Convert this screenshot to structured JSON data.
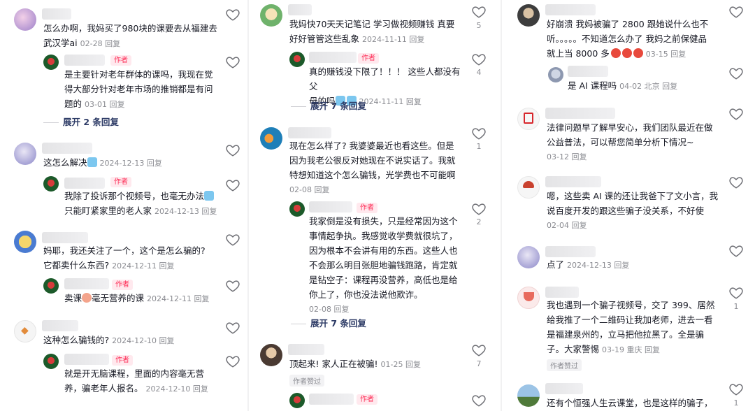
{
  "col1": {
    "c1": {
      "text": "怎么办啊，我妈买了980块的课要去从福建去武汉学ai",
      "meta": "02-28 回复"
    },
    "c1r": {
      "badge": "作者",
      "text": "是主要针对老年群体的课吗，我现在觉得大部分针对老年市场的推销都是有问题的",
      "meta": "03-01 回复"
    },
    "c1e": "展开 2 条回复",
    "c2": {
      "text": "这怎么解决",
      "meta": "2024-12-13 回复"
    },
    "c2r": {
      "badge": "作者",
      "text1": "我除了投诉那个视频号，也毫无办法",
      "text2": "只能盯紧家里的老人家",
      "meta": "2024-12-13 回复"
    },
    "c3": {
      "text1": "妈耶，我还关注了一个，这个是怎么骗的?",
      "text2": "它都卖什么东西?",
      "meta": "2024-12-11 回复"
    },
    "c3r": {
      "badge": "作者",
      "text_a": "卖课",
      "text_b": "毫无营养的课",
      "meta": "2024-12-11 回复"
    },
    "c4": {
      "text": "这种怎么骗钱的?",
      "meta": "2024-12-10 回复"
    },
    "c4r": {
      "badge": "作者",
      "text1": "就是开无脑课程，里面的内容毫无营",
      "text2": "养，骗老年人报名。",
      "meta": "2024-12-10 回复"
    }
  },
  "col2": {
    "c1": {
      "text1": "我妈快70天天记笔记 学习做视频赚钱 真要",
      "text2": "好好管管这些乱象",
      "meta": "2024-11-11 回复",
      "likes": "5"
    },
    "c1r": {
      "badge": "作者",
      "text1": "真的赚钱没下限了！！！ 这些人都没有父",
      "text2": "母的吗",
      "meta": "2024-11-11 回复",
      "likes": "4"
    },
    "c1e": "展开 7 条回复",
    "c2": {
      "text1": "现在怎么样了? 我婆婆最近也看这些。但是",
      "text2": "因为我老公很反对她现在不说实话了。我就",
      "text3": "特想知道这个怎么骗钱，光学费也不可能啊",
      "meta": "02-08 回复",
      "likes": "1"
    },
    "c2r": {
      "badge": "作者",
      "lines": [
        "我家倒是没有损失，只是经常因为这个",
        "事情起争执。我感觉收学费就很坑了，",
        "因为根本不会讲有用的东西。这些人也",
        "不会那么明目张胆地骗钱跑路，肯定就",
        "是钻空子：课程再没营养，高低也是给",
        "你上了，你也没法说他欺诈。"
      ],
      "meta": "02-08 回复",
      "likes": "2"
    },
    "c2e": "展开 7 条回复",
    "c3": {
      "text": "顶起来! 家人正在被骗!",
      "meta": "01-25 回复",
      "likes": "7",
      "liked": "作者赞过"
    },
    "c3r": {
      "badge": "作者"
    }
  },
  "col3": {
    "c1": {
      "text1": "好崩溃 我妈被骗了 2800 跟她说什么也不",
      "text2": "听。。。。。不知道怎么办了 我妈之前保健品",
      "text3": "就上当 8000 多",
      "meta": "03-15 回复"
    },
    "c1r": {
      "text": "是 AI 课程吗",
      "meta": "04-02 北京 回复"
    },
    "c2": {
      "text1": "法律问题早了解早安心，我们团队最近在做",
      "text2": "公益普法，可以帮您简单分析下情况~",
      "meta": "03-12 回复"
    },
    "c3": {
      "text1": "嗯，这些卖 AI 课的还让我爸下了文小言，我",
      "text2": "说百度开发的跟这些骗子没关系，不好使",
      "meta": "02-04 回复"
    },
    "c4": {
      "text": "点了",
      "meta": "2024-12-13 回复"
    },
    "c5": {
      "text1": "我也遇到一个骗子视频号，交了 399、居然",
      "text2": "给我推了一个二维码让我加老师，进去一看",
      "text3": "是福建泉州的，立马把他拉黑了。全是骗",
      "text4": "子。大家警惕",
      "meta": "03-19 重庆 回复",
      "likes": "1",
      "liked": "作者赞过"
    },
    "c6": {
      "text": "还有个恒强人生云课堂，也是这样的骗子，",
      "likes": "1"
    }
  },
  "colors": {
    "accent": "#fe2c55",
    "text": "#161823",
    "meta": "#8a8b91",
    "link": "#2d3b66"
  }
}
